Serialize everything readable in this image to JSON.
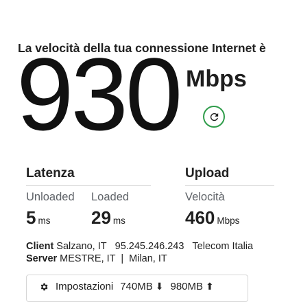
{
  "headline": "La velocità della tua connessione Internet è",
  "speed": {
    "value": "930",
    "unit": "Mbps"
  },
  "refresh": {
    "icon": "refresh-icon",
    "color": "#2e9c4a"
  },
  "latency": {
    "title": "Latenza",
    "unloaded_label": "Unloaded",
    "unloaded_value": "5",
    "unloaded_unit": "ms",
    "loaded_label": "Loaded",
    "loaded_value": "29",
    "loaded_unit": "ms"
  },
  "upload": {
    "title": "Upload",
    "speed_label": "Velocità",
    "speed_value": "460",
    "speed_unit": "Mbps"
  },
  "client": {
    "label": "Client",
    "location": "Salzano, IT",
    "ip": "95.245.246.243",
    "isp": "Telecom Italia"
  },
  "server": {
    "label": "Server",
    "locations": "MESTRE, IT  |  Milan, IT"
  },
  "settings_bar": {
    "label": "Impostazioni",
    "download_data": "740MB",
    "upload_data": "980MB"
  }
}
